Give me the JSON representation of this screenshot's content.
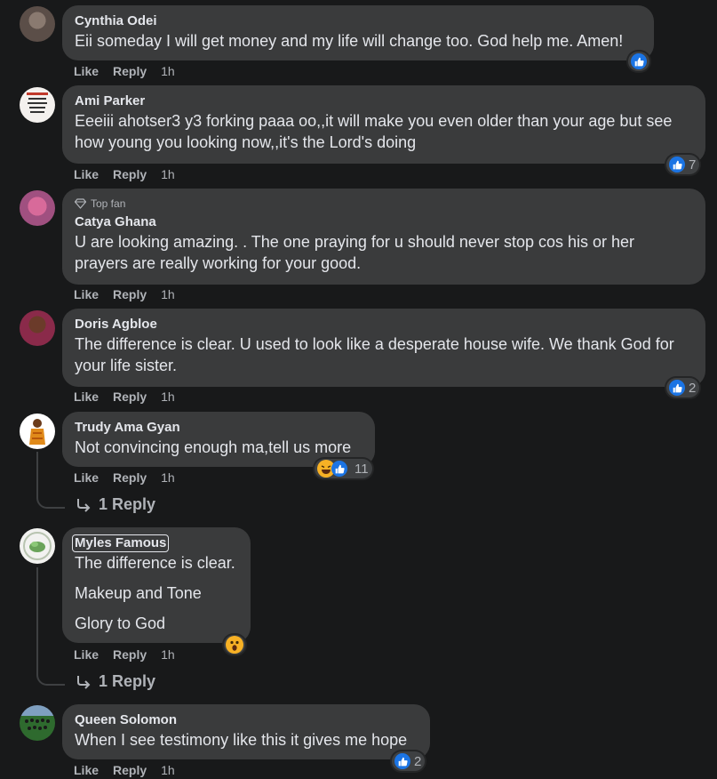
{
  "comments": [
    {
      "name": "Cynthia Odei",
      "text": [
        "Eii someday I will get money and my life will change too. God help me. Amen!"
      ],
      "like": "Like",
      "reply": "Reply",
      "time": "1h",
      "reaction_count": ""
    },
    {
      "name": "Ami Parker",
      "text": [
        "Eeeiii ahotser3 y3 forking paaa oo,,it will make you even older than your age but see",
        "how young you looking now,,it's the Lord's doing"
      ],
      "like": "Like",
      "reply": "Reply",
      "time": "1h",
      "reaction_count": "7"
    },
    {
      "badge": "Top fan",
      "name": "Catya Ghana",
      "text": [
        "U are looking amazing. . The one praying for u should never stop cos his or her",
        "prayers are really working for your good."
      ],
      "like": "Like",
      "reply": "Reply",
      "time": "1h",
      "reaction_count": ""
    },
    {
      "name": "Doris Agbloe",
      "text": [
        "The difference is clear. U used to look like a desperate house wife. We thank God for",
        "your life sister."
      ],
      "like": "Like",
      "reply": "Reply",
      "time": "1h",
      "reaction_count": "2"
    },
    {
      "name": "Trudy Ama Gyan",
      "text": [
        "Not convincing enough ma,tell us more"
      ],
      "like": "Like",
      "reply": "Reply",
      "time": "1h",
      "reaction_count": "11",
      "replies_label": "1 Reply"
    },
    {
      "name": "Myles Famous",
      "text": [
        "The difference is clear.",
        "Makeup and Tone",
        "Glory to God"
      ],
      "like": "Like",
      "reply": "Reply",
      "time": "1h",
      "reaction_count": "",
      "replies_label": "1 Reply"
    },
    {
      "name": "Queen Solomon",
      "text": [
        "When I see testimony like this it gives me hope"
      ],
      "like": "Like",
      "reply": "Reply",
      "time": "1h",
      "reaction_count": "2"
    }
  ],
  "colors": {
    "background": "#18191a",
    "bubble": "#3a3b3c",
    "text": "#e4e6eb",
    "secondary": "#b0b3b8",
    "like_blue": "#1b74e4",
    "emoji_yellow": "#f7b125"
  },
  "icons": [
    "like-icon",
    "haha-icon",
    "wow-icon",
    "diamond-icon",
    "reply-arrow-icon"
  ]
}
